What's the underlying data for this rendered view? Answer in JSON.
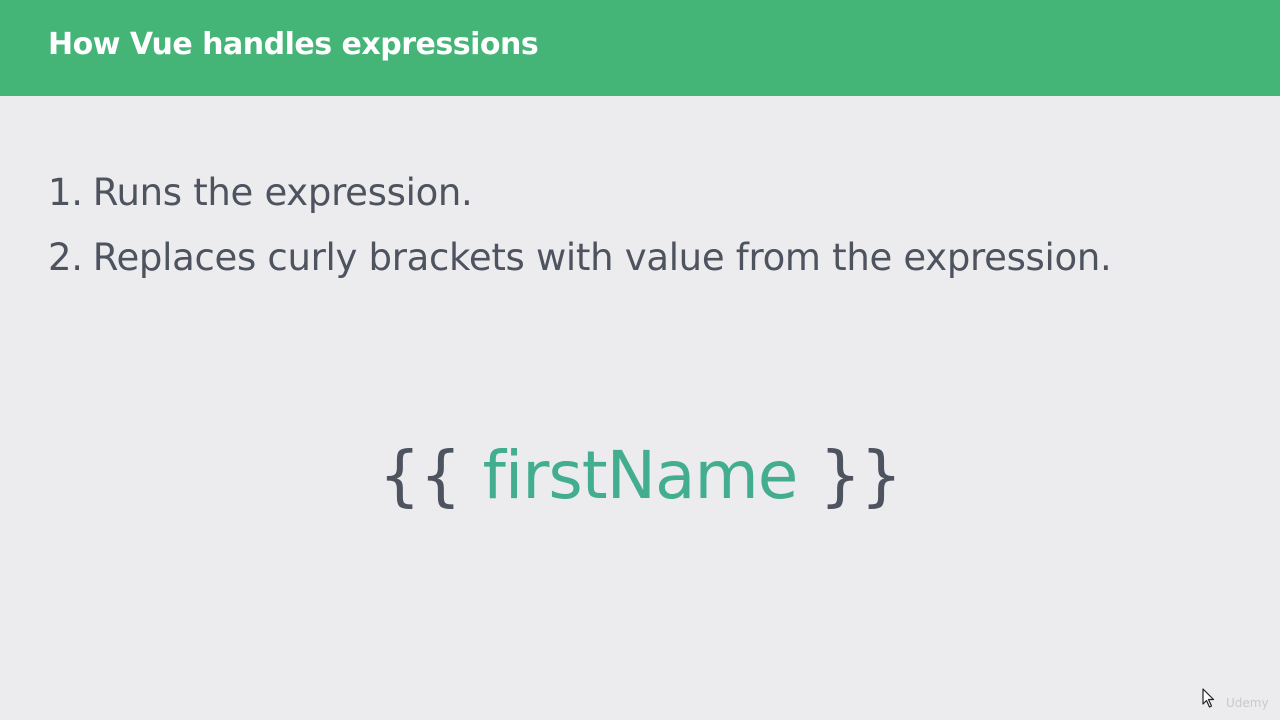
{
  "header": {
    "title": "How Vue handles expressions"
  },
  "steps": [
    {
      "number": "1.",
      "text": "Runs the expression."
    },
    {
      "number": "2.",
      "text": "Replaces curly brackets with value from the expression."
    }
  ],
  "expression": {
    "open_brace": "{{",
    "variable": "firstName",
    "close_brace": "}}"
  },
  "watermark": "Udemy",
  "colors": {
    "header_bg": "#44b577",
    "body_bg": "#ecebee",
    "text": "#4e5360",
    "variable": "#43ad8f"
  },
  "icons": {
    "cursor": "mouse-pointer-icon"
  }
}
